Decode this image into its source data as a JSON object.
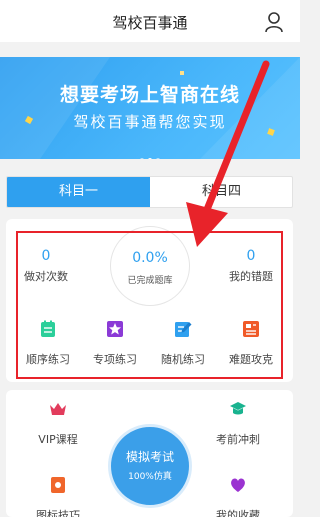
{
  "header": {
    "title": "驾校百事通",
    "user_icon": "user-icon"
  },
  "banner": {
    "line1": "想要考场上智商在线",
    "line2": "驾校百事通帮您实现",
    "color": "#3ba8f5"
  },
  "tabs": [
    {
      "label": "科目一",
      "active": true
    },
    {
      "label": "科目四",
      "active": false
    }
  ],
  "stats": {
    "correct_count": "0",
    "correct_label": "做对次数",
    "completion": "0.0%",
    "completion_label": "已完成题库",
    "wrong_count": "0",
    "wrong_label": "我的错题"
  },
  "practice": [
    {
      "label": "顺序练习",
      "icon": "notebook-icon",
      "color": "#2bcf9a"
    },
    {
      "label": "专项练习",
      "icon": "star-icon",
      "color": "#8b3ad6"
    },
    {
      "label": "随机练习",
      "icon": "edit-icon",
      "color": "#2fa0ef"
    },
    {
      "label": "难题攻克",
      "icon": "document-icon",
      "color": "#f05a28"
    }
  ],
  "features": [
    {
      "label": "VIP课程",
      "icon": "crown-icon",
      "color": "#e23c5c"
    },
    {
      "label": "考前冲刺",
      "icon": "graduation-cap-icon",
      "color": "#19b38f"
    },
    {
      "label": "图标技巧",
      "icon": "book-icon",
      "color": "#f0662b"
    },
    {
      "label": "我的收藏",
      "icon": "heart-icon",
      "color": "#9b33d1"
    }
  ],
  "mock_exam": {
    "title": "模拟考试",
    "subtitle": "100%仿真"
  },
  "accent": "#2fa0ef",
  "highlight_color": "#e8232a"
}
